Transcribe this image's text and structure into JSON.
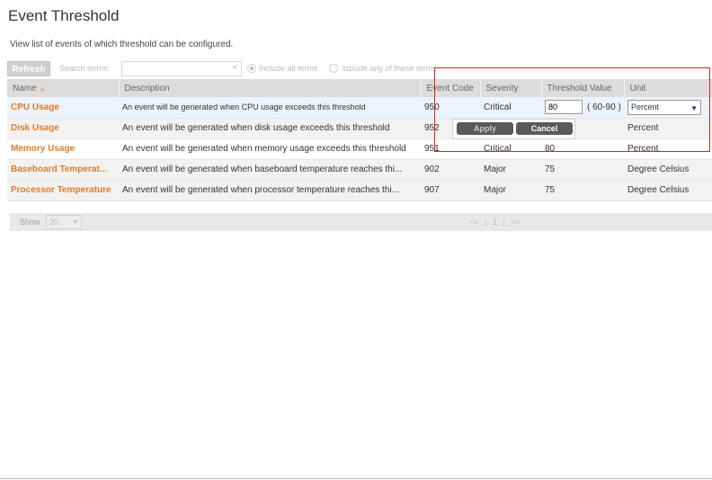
{
  "page": {
    "title": "Event Threshold",
    "subtitle": "View list of events of which threshold can be configured."
  },
  "toolbar": {
    "refresh_label": "Refresh",
    "search_label": "Search terms:",
    "search_value": "",
    "radio_all_label": "Include all terms",
    "radio_any_label": "Include any of these terms"
  },
  "table": {
    "headers": {
      "name": "Name",
      "description": "Description",
      "event_code": "Event Code",
      "severity": "Severity",
      "threshold": "Threshold Value",
      "unit": "Unit"
    },
    "rows": [
      {
        "name": "CPU Usage",
        "description": "An event will be generated when CPU usage exceeds this threshold",
        "code": "950",
        "severity": "Critical",
        "threshold": "80",
        "range": "( 60-90 )",
        "unit": "Percent"
      },
      {
        "name": "Disk Usage",
        "description": "An event will be generated when disk usage exceeds this threshold",
        "code": "952",
        "severity": "",
        "threshold": "",
        "unit": "Percent"
      },
      {
        "name": "Memory Usage",
        "description": "An event will be generated when memory usage exceeds this threshold",
        "code": "951",
        "severity": "Critical",
        "threshold": "80",
        "unit": "Percent"
      },
      {
        "name": "Baseboard Temperat...",
        "description": "An event will be generated when baseboard temperature reaches thi...",
        "code": "902",
        "severity": "Major",
        "threshold": "75",
        "unit": "Degree Celsius"
      },
      {
        "name": "Processor Temperature",
        "description": "An event will be generated when processor temperature reaches thi...",
        "code": "907",
        "severity": "Major",
        "threshold": "75",
        "unit": "Degree Celsius"
      }
    ]
  },
  "popup": {
    "apply_label": "Apply",
    "cancel_label": "Cancel"
  },
  "pager": {
    "show_label": "Show",
    "page_size": "20",
    "first": "<<",
    "sep1": "|",
    "current": "1",
    "sep2": "|",
    "next": ">>"
  },
  "colors": {
    "accent": "#e07b2a",
    "highlight": "#e02020",
    "header_bg": "#dcdcdc"
  }
}
